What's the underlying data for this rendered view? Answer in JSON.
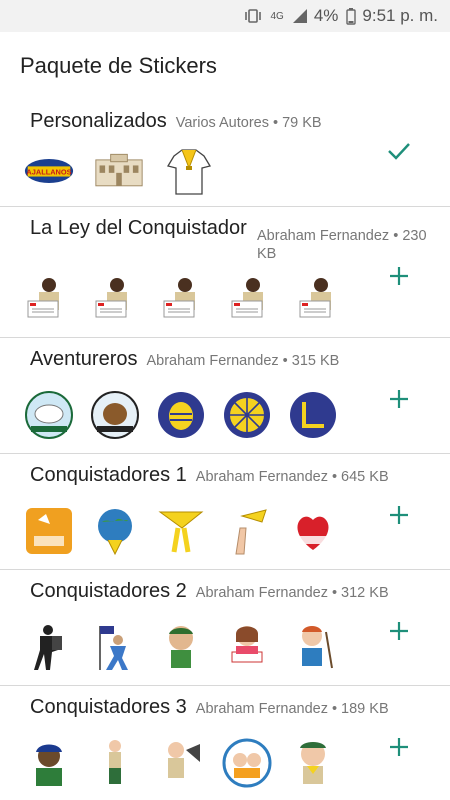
{
  "status_bar": {
    "network": "4G",
    "battery": "4%",
    "time": "9:51 p. m."
  },
  "header": {
    "title": "Paquete de Stickers"
  },
  "colors": {
    "accent": "#1e8f7a",
    "divider": "#d8d8d8"
  },
  "packs": [
    {
      "name": "Personalizados",
      "author": "Varios Autores",
      "size": "79 KB",
      "action": "check",
      "stickers": [
        "aj-allanos-logo",
        "building-drawing",
        "scout-uniform-shirt"
      ]
    },
    {
      "name": "La Ley del Conquistador",
      "author": "Abraham Fernandez",
      "size": "230 KB",
      "action": "add",
      "stickers": [
        "pathfinder-holding-sign",
        "pathfinder-holding-sign",
        "pathfinder-holding-sign",
        "pathfinder-holding-sign",
        "pathfinder-holding-sign"
      ]
    },
    {
      "name": "Aventureros",
      "author": "Abraham Fernandez",
      "size": "315 KB",
      "action": "add",
      "stickers": [
        "corderitos-badge",
        "castores-badge",
        "bee-badge",
        "sun-badge",
        "blue-badge"
      ]
    },
    {
      "name": "Conquistadores 1",
      "author": "Abraham Fernandez",
      "size": "645 KB",
      "action": "add",
      "stickers": [
        "feliz-sabado-orange",
        "globe-scarf",
        "yellow-scarf",
        "hand-scarf",
        "feliz-sabado-red"
      ]
    },
    {
      "name": "Conquistadores 2",
      "author": "Abraham Fernandez",
      "size": "312 KB",
      "action": "add",
      "stickers": [
        "hiker-silhouette",
        "flag-runner",
        "cartoon-boy-green",
        "girl-reading",
        "boy-with-stick"
      ]
    },
    {
      "name": "Conquistadores 3",
      "author": "Abraham Fernandez",
      "size": "189 KB",
      "action": "add",
      "stickers": [
        "boy-cap-portrait",
        "scout-standing",
        "scout-megaphone",
        "kids-circle",
        "scout-boy-waving"
      ]
    }
  ]
}
